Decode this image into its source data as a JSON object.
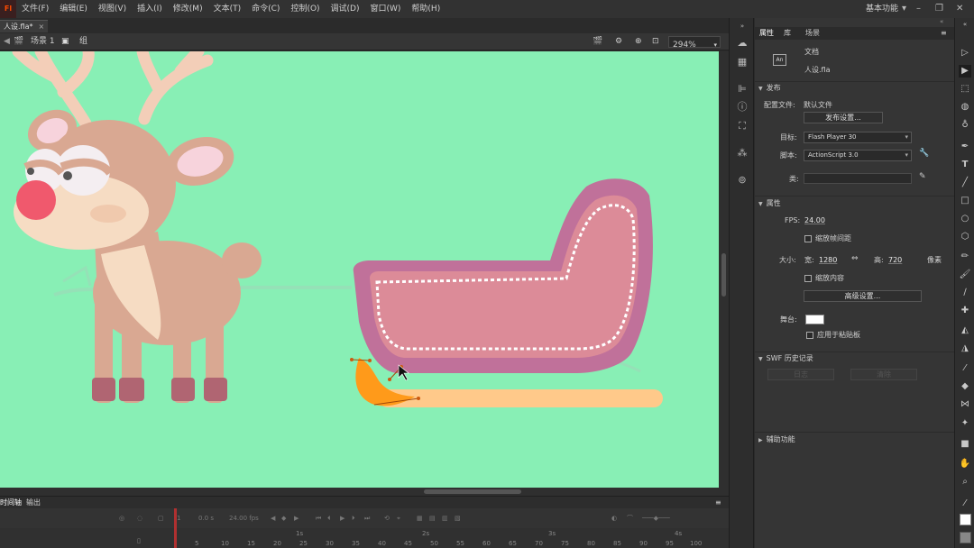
{
  "app": {
    "logo": "Fl"
  },
  "menu": {
    "items": [
      "文件(F)",
      "编辑(E)",
      "视图(V)",
      "插入(I)",
      "修改(M)",
      "文本(T)",
      "命令(C)",
      "控制(O)",
      "调试(D)",
      "窗口(W)",
      "帮助(H)"
    ],
    "workspace": "基本功能"
  },
  "document": {
    "tab": "人设.fla*",
    "close": "×"
  },
  "editbar": {
    "scene": "场景 1",
    "group": "组",
    "zoom": "294%"
  },
  "panel": {
    "tabs": [
      "属性",
      "库",
      "场景"
    ],
    "doc_type": "文档",
    "doc_name": "人设.fla",
    "publish": {
      "title": "发布",
      "profile_label": "配置文件:",
      "profile_value": "默认文件",
      "settings_button": "发布设置...",
      "target_label": "目标:",
      "target_value": "Flash Player 30",
      "script_label": "脚本:",
      "script_value": "ActionScript 3.0",
      "class_label": "类:"
    },
    "properties": {
      "title": "属性",
      "fps_label": "FPS:",
      "fps_value": "24.00",
      "scale_spans": "缩放帧间距",
      "size_label": "大小:",
      "width_label": "宽:",
      "width_value": "1280",
      "height_label": "高:",
      "height_value": "720",
      "units": "像素",
      "scale_content": "缩放内容",
      "advanced_button": "高级设置...",
      "stage_label": "舞台:",
      "stage_color": "#ffffff",
      "apply_pasteboard": "应用于粘贴板"
    },
    "swf_history": {
      "title": "SWF 历史记录",
      "log_button": "日志",
      "clear_button": "清除"
    },
    "accessibility": {
      "title": "辅助功能"
    }
  },
  "timeline": {
    "tabs": [
      "时间轴",
      "输出"
    ],
    "frame_value": "1",
    "time_value": "0.0 s",
    "fps_value": "24.00 fps",
    "seconds": [
      "1s",
      "2s",
      "3s",
      "4s"
    ],
    "frame_numbers": [
      "5",
      "10",
      "15",
      "20",
      "25",
      "30",
      "35",
      "40",
      "45",
      "50",
      "55",
      "60",
      "65",
      "70",
      "75",
      "80",
      "85",
      "90",
      "95",
      "100"
    ]
  },
  "colors": {
    "stage": "#88efb5",
    "reindeer_body": "#d9a892",
    "reindeer_belly": "#f6dcc3",
    "antler": "#f3ceb8",
    "nose": "#f0596d",
    "hoof": "#b06572",
    "sleigh_frame": "#c0719a",
    "sleigh_body": "#dc8b98",
    "runner": "#ffc98a",
    "selected_shape": "#ff9a1a"
  },
  "icons": {
    "mid_column": [
      "library-icon",
      "swatches-icon",
      "align-icon",
      "info-icon",
      "transform-icon",
      "motion-presets-icon",
      "cc-libraries-icon"
    ],
    "tools": [
      "subselection-icon",
      "selection-icon",
      "free-transform-icon",
      "3d-rotation-icon",
      "lasso-icon",
      "pen-icon",
      "text-icon",
      "line-icon",
      "rectangle-icon",
      "oval-icon",
      "polystar-icon",
      "pencil-icon",
      "brush-icon",
      "paint-brush-icon",
      "bone-icon",
      "paint-bucket-icon",
      "ink-bottle-icon",
      "eyedropper-icon",
      "eraser-icon",
      "width-icon",
      "pin-icon",
      "camera-icon",
      "hand-icon",
      "zoom-icon",
      "stroke-color-icon",
      "fill-color-icon"
    ]
  }
}
